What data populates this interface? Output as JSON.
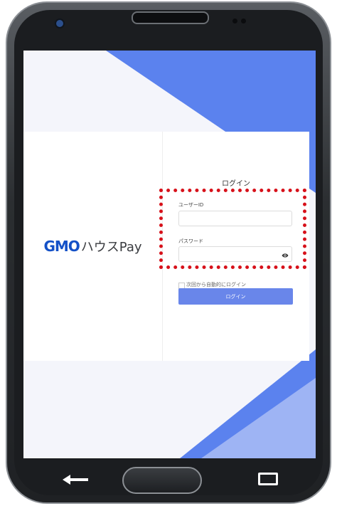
{
  "brand": {
    "gmo": "GMO",
    "name": "ハウスPay",
    "gmo_color": "#1451c7"
  },
  "login": {
    "title": "ログイン",
    "user_id_label": "ユーザーID",
    "user_id_value": "",
    "password_label": "パスワード",
    "password_value": "",
    "remember_label": "次回から自動的にログイン",
    "remember_checked": false,
    "submit_label": "ログイン"
  },
  "colors": {
    "accent": "#5b82ee",
    "button": "#6986ea",
    "highlight": "#d7111a"
  },
  "icons": {
    "password_toggle": "eye-icon",
    "nav_back": "back-arrow-icon",
    "nav_home": "home-button",
    "nav_recent": "recent-apps-icon"
  }
}
